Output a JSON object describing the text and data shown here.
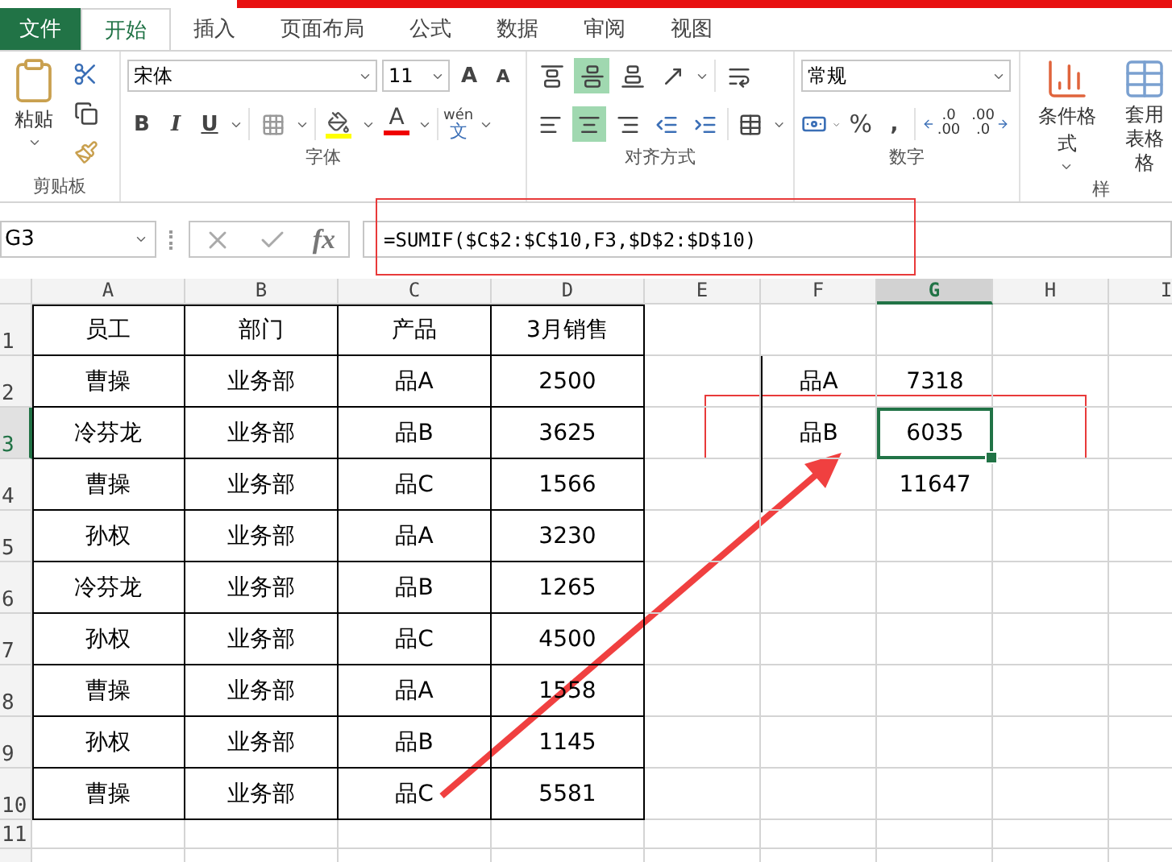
{
  "tabs": [
    {
      "label": "文件",
      "kind": "file",
      "selected": false
    },
    {
      "label": "开始",
      "kind": "tab",
      "selected": true
    },
    {
      "label": "插入",
      "kind": "tab",
      "selected": false
    },
    {
      "label": "页面布局",
      "kind": "tab",
      "selected": false
    },
    {
      "label": "公式",
      "kind": "tab",
      "selected": false
    },
    {
      "label": "数据",
      "kind": "tab",
      "selected": false
    },
    {
      "label": "审阅",
      "kind": "tab",
      "selected": false
    },
    {
      "label": "视图",
      "kind": "tab",
      "selected": false
    }
  ],
  "ribbon": {
    "clipboard": {
      "label": "剪贴板",
      "paste": "粘贴"
    },
    "font": {
      "label": "字体",
      "name": "宋体",
      "size": "11",
      "grow": "A",
      "shrink": "A",
      "bold": "B",
      "italic": "I",
      "underline": "U",
      "font_color": "A",
      "phonetic": "wén",
      "phonetic_char": "文"
    },
    "alignment": {
      "label": "对齐方式",
      "vertical": [
        {
          "kind": "top",
          "selected": false
        },
        {
          "kind": "middle",
          "selected": true
        },
        {
          "kind": "bottom",
          "selected": false
        }
      ],
      "horizontal": [
        {
          "kind": "left",
          "selected": false
        },
        {
          "kind": "center",
          "selected": true
        },
        {
          "kind": "right",
          "selected": false
        }
      ]
    },
    "number": {
      "label": "数字",
      "format": "常规",
      "percent": "%",
      "comma": ",",
      "increase_decimal": [
        ".0",
        ".00"
      ],
      "decrease_decimal": [
        ".00",
        ".0"
      ]
    },
    "styles": {
      "label": "样",
      "conditional": "条件格式",
      "table_format": [
        "套用",
        "表格格"
      ]
    }
  },
  "formula_bar": {
    "name_box": "G3",
    "fx": "fx",
    "formula": "=SUMIF($C$2:$C$10,F3,$D$2:$D$10)"
  },
  "sheet": {
    "columns": [
      {
        "label": "A",
        "selected": false
      },
      {
        "label": "B",
        "selected": false
      },
      {
        "label": "C",
        "selected": false
      },
      {
        "label": "D",
        "selected": false
      },
      {
        "label": "E",
        "selected": false
      },
      {
        "label": "F",
        "selected": false
      },
      {
        "label": "G",
        "selected": true
      },
      {
        "label": "H",
        "selected": false
      },
      {
        "label": "I",
        "selected": false
      }
    ],
    "rows": [
      {
        "label": "1",
        "selected": false,
        "data": [
          "员工",
          "部门",
          "产品",
          "3月销售"
        ]
      },
      {
        "label": "2",
        "selected": false,
        "data": [
          "曹操",
          "业务部",
          "品A",
          "2500"
        ],
        "summary": {
          "label": "品A",
          "value": "7318",
          "selected": false
        }
      },
      {
        "label": "3",
        "selected": true,
        "data": [
          "冷芬龙",
          "业务部",
          "品B",
          "3625"
        ],
        "summary": {
          "label": "品B",
          "value": "6035",
          "selected": true
        }
      },
      {
        "label": "4",
        "selected": false,
        "data": [
          "曹操",
          "业务部",
          "品C",
          "1566"
        ],
        "summary": {
          "value": "11647",
          "selected": false
        }
      },
      {
        "label": "5",
        "selected": false,
        "data": [
          "孙权",
          "业务部",
          "品A",
          "3230"
        ]
      },
      {
        "label": "6",
        "selected": false,
        "data": [
          "冷芬龙",
          "业务部",
          "品B",
          "1265"
        ]
      },
      {
        "label": "7",
        "selected": false,
        "data": [
          "孙权",
          "业务部",
          "品C",
          "4500"
        ]
      },
      {
        "label": "8",
        "selected": false,
        "data": [
          "曹操",
          "业务部",
          "品A",
          "1558"
        ]
      },
      {
        "label": "9",
        "selected": false,
        "data": [
          "孙权",
          "业务部",
          "品B",
          "1145"
        ]
      },
      {
        "label": "10",
        "selected": false,
        "data": [
          "曹操",
          "业务部",
          "品C",
          "5581"
        ]
      },
      {
        "label": "11",
        "selected": false
      }
    ]
  }
}
